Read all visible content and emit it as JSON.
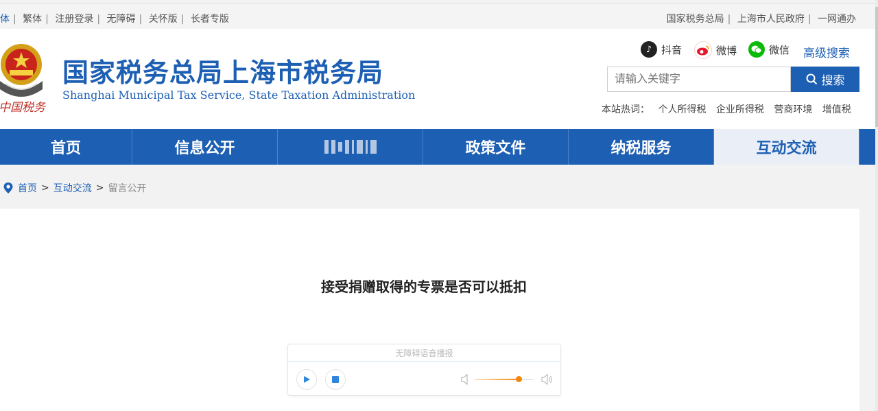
{
  "topbar": {
    "left": [
      "体",
      "繁体",
      "注册登录",
      "无障碍",
      "关怀版",
      "长者专版"
    ],
    "right": [
      "国家税务总局",
      "上海市人民政府",
      "一网通办"
    ]
  },
  "header": {
    "title_cn": "国家税务总局上海市税务局",
    "title_en": "Shanghai Municipal Tax Service, State Taxation Administration",
    "signature": "中国税务",
    "social": [
      {
        "icon": "douyin-icon",
        "label": "抖音",
        "color": "#222222"
      },
      {
        "icon": "weibo-icon",
        "label": "微博",
        "color": "#e6162d"
      },
      {
        "icon": "wechat-icon",
        "label": "微信",
        "color": "#09bb07"
      }
    ],
    "advanced_search": "高级搜索",
    "search": {
      "placeholder": "请输入关键字",
      "button": "搜索"
    },
    "hot": {
      "label": "本站热词：",
      "items": [
        "个人所得税",
        "企业所得税",
        "营商环境",
        "增值税"
      ]
    }
  },
  "nav": {
    "items": [
      "首页",
      "信息公开",
      "",
      "政策文件",
      "纳税服务",
      "互动交流"
    ],
    "active_index": 5
  },
  "breadcrumb": {
    "home": "首页",
    "section": "互动交流",
    "current": "留言公开",
    "sep": ">"
  },
  "article": {
    "title": "接受捐赠取得的专票是否可以抵扣"
  },
  "player": {
    "label": "无障碍语音播报",
    "volume": 0.75,
    "accent": "#f3860c"
  }
}
